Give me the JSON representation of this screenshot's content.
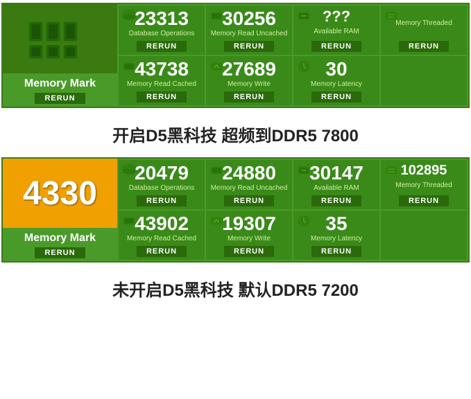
{
  "panels": [
    {
      "id": "top-panel",
      "show_score": false,
      "score": "",
      "memory_mark_label": "Memory Mark",
      "rerun_label": "RERUN",
      "metrics": [
        {
          "value": "23313",
          "label": "Database Operations",
          "rerun": "RERUN"
        },
        {
          "value": "30256",
          "label": "Memory Read\nUncached",
          "rerun": "RERUN"
        },
        {
          "value": "???",
          "label": "Available RAM",
          "rerun": "RERUN"
        },
        {
          "value": "",
          "label": "Memory Threaded",
          "rerun": "RERUN"
        },
        {
          "value": "43738",
          "label": "Memory Read Cached",
          "rerun": "RERUN"
        },
        {
          "value": "27689",
          "label": "Memory Write",
          "rerun": "RERUN"
        },
        {
          "value": "30",
          "label": "Memory Latency",
          "rerun": "RERUN"
        },
        {
          "value": "",
          "label": "",
          "rerun": ""
        }
      ]
    },
    {
      "id": "bottom-panel",
      "show_score": true,
      "score": "4330",
      "memory_mark_label": "Memory Mark",
      "rerun_label": "RERUN",
      "metrics": [
        {
          "value": "20479",
          "label": "Database Operations",
          "rerun": "RERUN"
        },
        {
          "value": "24880",
          "label": "Memory Read\nUncached",
          "rerun": "RERUN"
        },
        {
          "value": "30147",
          "label": "Available RAM",
          "rerun": "RERUN"
        },
        {
          "value": "102895",
          "label": "Memory Threaded",
          "rerun": "RERUN"
        },
        {
          "value": "43902",
          "label": "Memory Read Cached",
          "rerun": "RERUN"
        },
        {
          "value": "19307",
          "label": "Memory Write",
          "rerun": "RERUN"
        },
        {
          "value": "35",
          "label": "Memory Latency",
          "rerun": "RERUN"
        },
        {
          "value": "",
          "label": "",
          "rerun": ""
        }
      ]
    }
  ],
  "separator1": {
    "text": "开启D5黑科技 超频到DDR5 7800"
  },
  "separator2": {
    "text": "未开启D5黑科技 默认DDR5 7200"
  }
}
